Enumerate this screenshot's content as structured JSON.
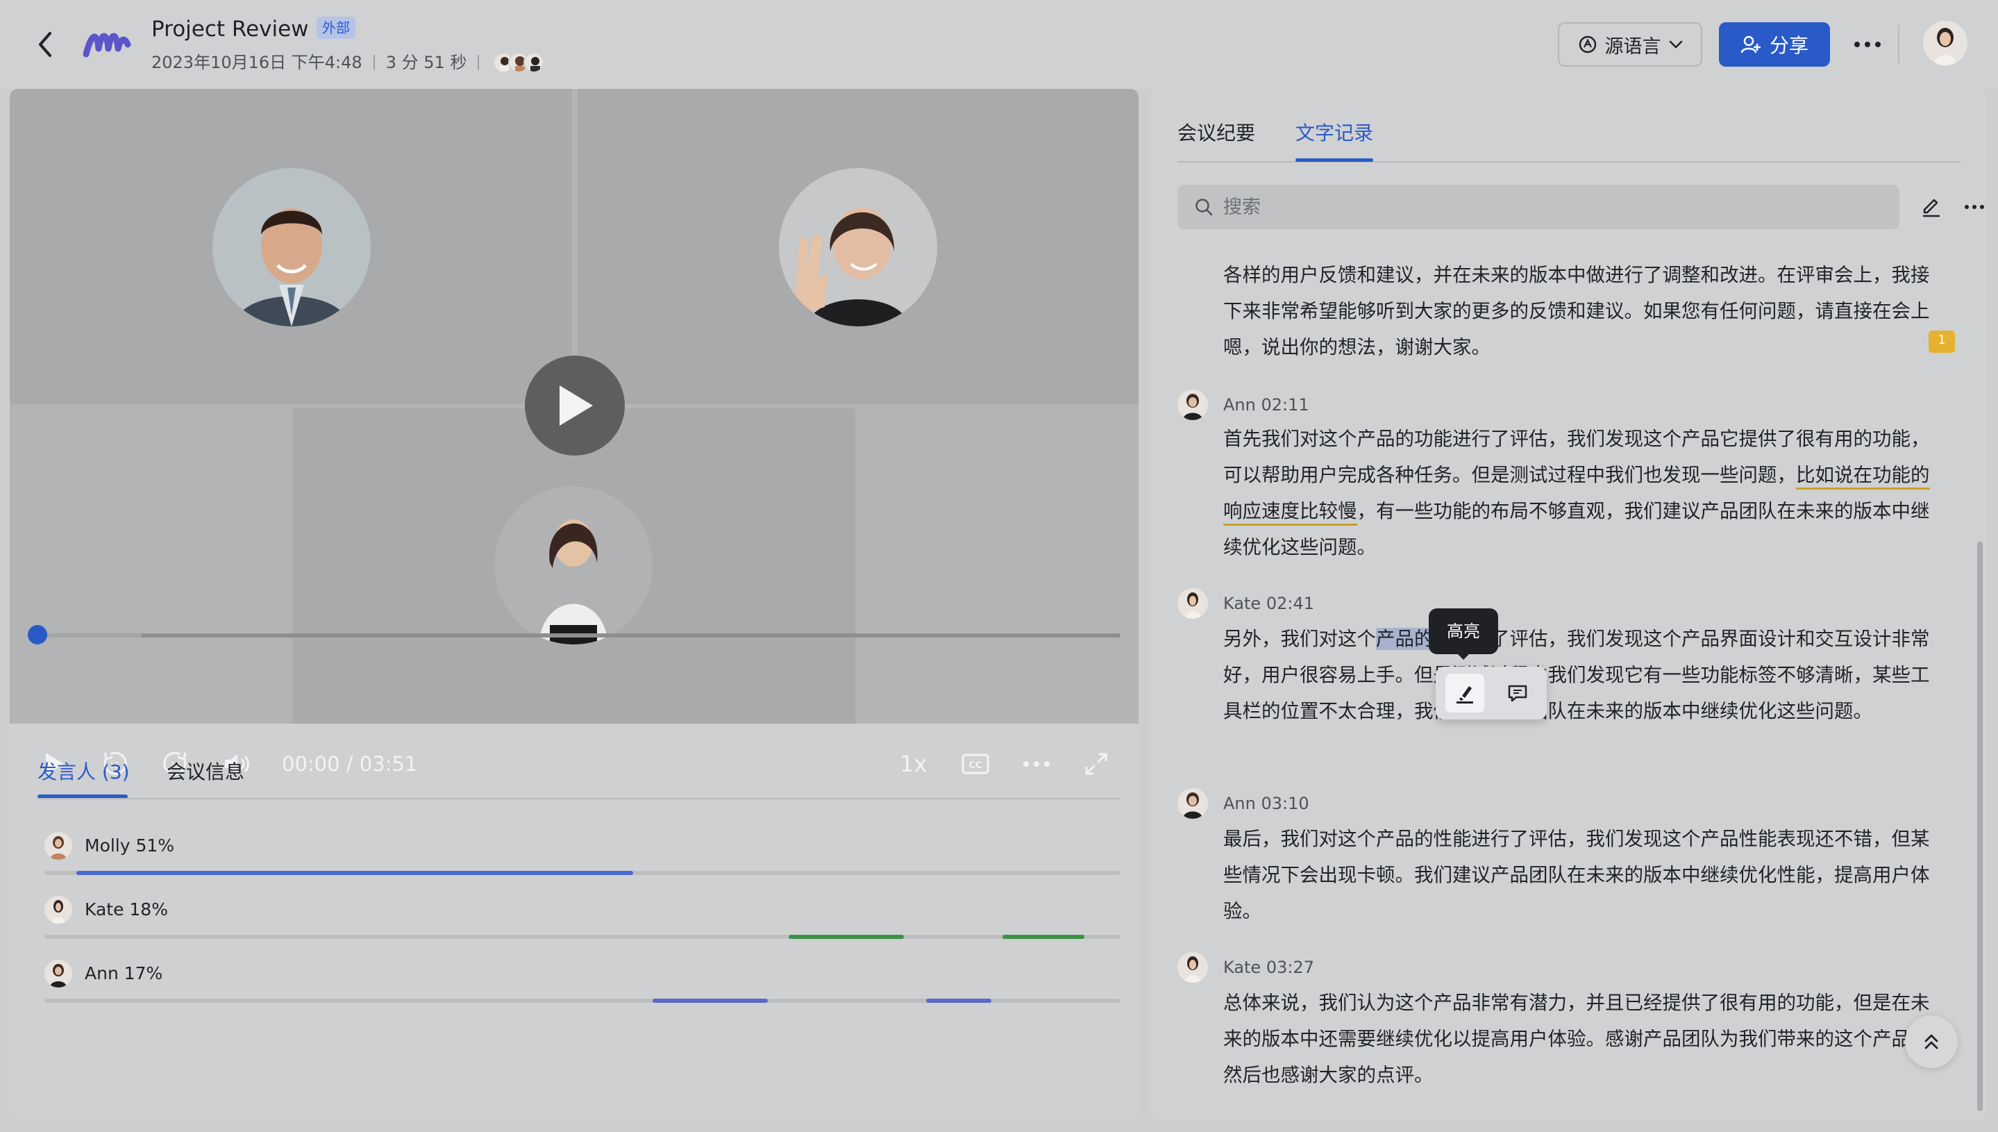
{
  "header": {
    "title": "Project Review",
    "badge": "外部",
    "date": "2023年10月16日 下午4:48",
    "duration": "3 分 51 秒",
    "lang_button": "源语言",
    "share_button": "分享"
  },
  "video": {
    "time": "00:00 / 03:51",
    "speed": "1x",
    "progress": 0.0
  },
  "left_tabs": [
    "发言人 (3)",
    "会议信息"
  ],
  "speakers": [
    {
      "label": "Molly 51%",
      "color": "#4a6ad0"
    },
    {
      "label": "Kate 18%",
      "color": "#3d9147"
    },
    {
      "label": "Ann 17%",
      "color": "#5a6ac8"
    }
  ],
  "right_tabs": [
    "会议纪要",
    "文字记录"
  ],
  "search": {
    "placeholder": "搜索"
  },
  "transcript": {
    "p0": "各样的用户反馈和建议，并在未来的版本中做进行了调整和改进。在评审会上，我接下来非常希望能够听到大家的更多的反馈和建议。如果您有任何问题，请直接在会上嗯，说出你的想法，谢谢大家。",
    "s1_meta": "Ann  02:11",
    "p1_a": "首先我们对这个产品的功能进行了评估，我们发现这个产品它提供了很有用的功能，可以帮助用户完成各种任务。但是测试过程中我们也发现一些问题，",
    "p1_b": "比如说在功能的响应速度比较慢",
    "p1_c": "，有一些功能的布局不够直观，我们建议产品团队在未来的版本中继续优化这些问题。",
    "comment_count": "1",
    "s2_meta": "Kate  02:41",
    "p2_a": "另外，我们对这个",
    "p2_b": "产品的",
    "p2_c": "也进行了评估，我们发现这个产品界面设计和交互设计非常好，用户很容易",
    "p2_d": "上手。但是测试过程中我们发现它有一些功能标签不够清晰，某些工具栏的位置",
    "p2_e": "不太合理，我们建议产品团队在未来的版本中继续优化这些问题。",
    "s3_meta": "Ann  03:10",
    "p3": "最后，我们对这个产品的性能进行了评估，我们发现这个产品性能表现还不错，但某些情况下会出现卡顿。我们建议产品团队在未来的版本中继续优化性能，提高用户体验。",
    "s4_meta": "Kate  03:27",
    "p4": "总体来说，我们认为这个产品非常有潜力，并且已经提供了很有用的功能，但是在未来的版本中还需要继续优化以提高用户体验。感谢产品团队为我们带来的这个产品，然后也感谢大家的点评。"
  },
  "tooltip": "高亮"
}
